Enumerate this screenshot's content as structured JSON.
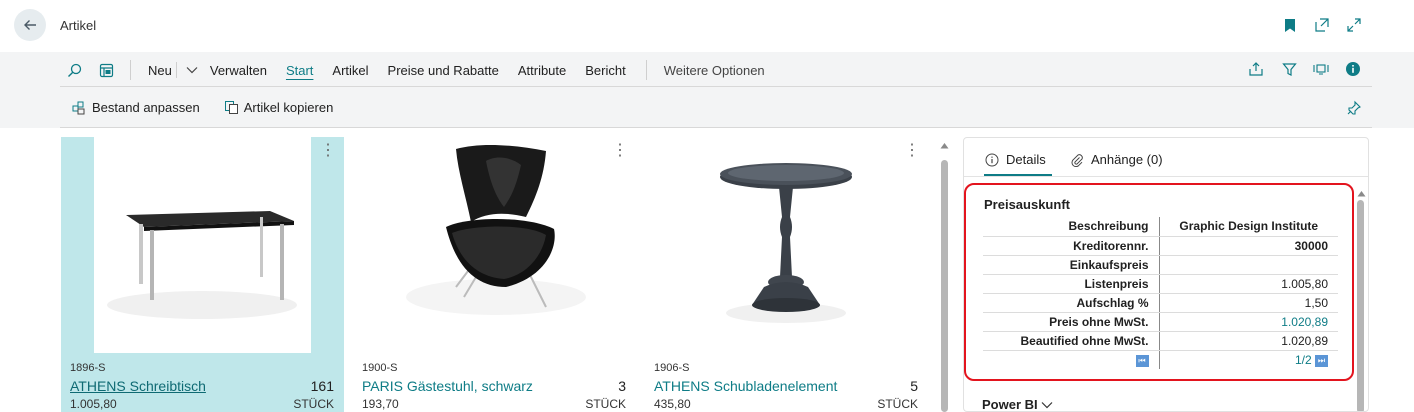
{
  "page": {
    "title": "Artikel"
  },
  "header_icons": [
    "bookmark-icon",
    "open-new-window-icon",
    "expand-icon"
  ],
  "action_bar": {
    "items": [
      {
        "label": "Neu"
      },
      {
        "label": "Verwalten"
      },
      {
        "label": "Start",
        "active": true
      },
      {
        "label": "Artikel"
      },
      {
        "label": "Preise und Rabatte"
      },
      {
        "label": "Attribute"
      },
      {
        "label": "Bericht"
      }
    ],
    "more_label": "Weitere Optionen"
  },
  "sub_actions": [
    {
      "label": "Bestand anpassen",
      "icon": "adjust-inventory-icon"
    },
    {
      "label": "Artikel kopieren",
      "icon": "copy-item-icon"
    }
  ],
  "cards": [
    {
      "no": "1896-S",
      "name": "ATHENS Schreibtisch",
      "inventory": "161",
      "price": "1.005,80",
      "unit": "STÜCK",
      "selected": true,
      "image": "desk-image"
    },
    {
      "no": "1900-S",
      "name": "PARIS Gästestuhl, schwarz",
      "inventory": "3",
      "price": "193,70",
      "unit": "STÜCK",
      "selected": false,
      "image": "chair-image"
    },
    {
      "no": "1906-S",
      "name": "ATHENS Schubladenelement",
      "inventory": "5",
      "price": "435,80",
      "unit": "STÜCK",
      "selected": false,
      "image": "table-image"
    }
  ],
  "factbox": {
    "tabs": [
      {
        "label": "Details",
        "icon": "info-icon",
        "active": true
      },
      {
        "label": "Anhänge (0)",
        "icon": "paperclip-icon",
        "active": false
      }
    ],
    "price_section": {
      "title": "Preisauskunft",
      "rows": [
        {
          "label": "Beschreibung",
          "value": "Graphic Design Institute"
        },
        {
          "label": "Kreditorennr.",
          "value": "30000"
        },
        {
          "label": "Einkaufspreis",
          "value": ""
        },
        {
          "label": "Listenpreis",
          "value": "1.005,80"
        },
        {
          "label": "Aufschlag %",
          "value": "1,50"
        },
        {
          "label": "Preis ohne MwSt.",
          "value": "1.020,89"
        },
        {
          "label": "Beautified ohne MwSt.",
          "value": "1.020,89"
        }
      ],
      "pager": "1/2"
    },
    "powerbi_label": "Power BI"
  },
  "colors": {
    "accent": "#0e7c86",
    "selected_card": "#bfe7ea",
    "highlight_border": "#e3141e",
    "pager_button": "#5b95d6"
  }
}
